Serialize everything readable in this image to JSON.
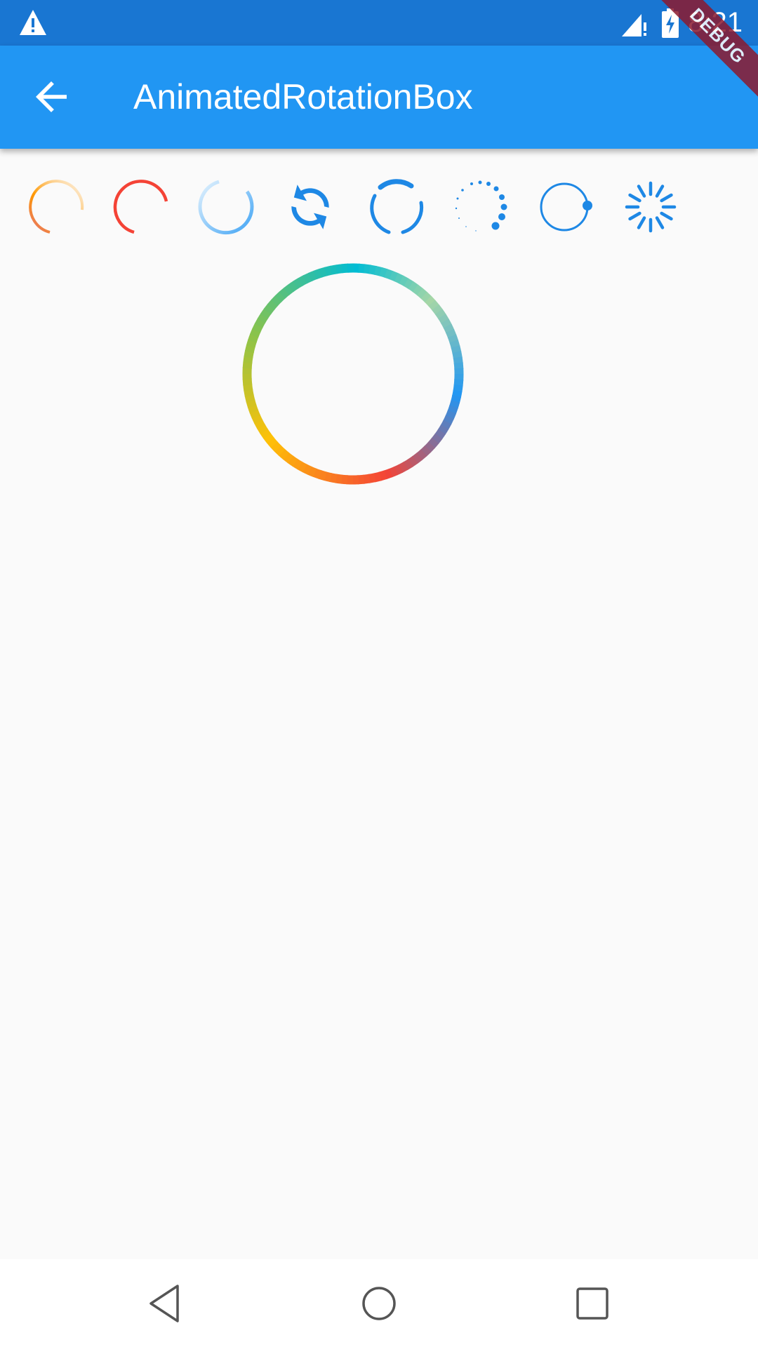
{
  "status_bar": {
    "time": "8:21",
    "icons": [
      "warning-icon",
      "signal-icon",
      "battery-charging-icon"
    ]
  },
  "debug_banner": "DEBUG",
  "app_bar": {
    "title": "AnimatedRotationBox",
    "back_icon": "arrow-back-icon"
  },
  "spinners": [
    "orange-gradient-arc",
    "red-arc",
    "blue-gradient-arc",
    "sync-arrows",
    "double-arc",
    "dots-circle",
    "circle-with-dot",
    "spoke-spinner"
  ],
  "big_ring": {
    "colors": [
      "#00bcd4",
      "#a5d6a7",
      "#2196f3",
      "#f44336",
      "#ffc107",
      "#8bc34a"
    ]
  },
  "nav_bar": {
    "icons": [
      "back-triangle-icon",
      "home-circle-icon",
      "recents-square-icon"
    ]
  }
}
